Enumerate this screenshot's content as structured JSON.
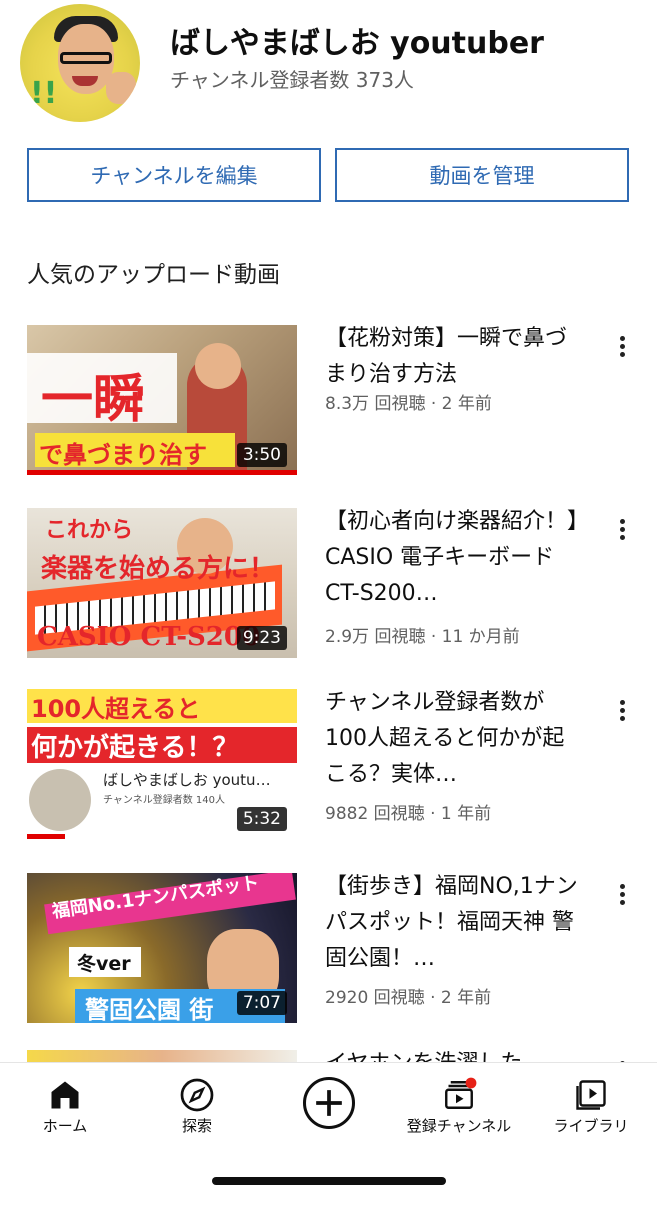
{
  "channel": {
    "name": "ばしやまばしお youtuber",
    "subscribers": "チャンネル登録者数 373人"
  },
  "buttons": {
    "edit": "チャンネルを編集",
    "manage": "動画を管理"
  },
  "section": {
    "title": "人気のアップロード動画"
  },
  "videos": [
    {
      "title": "【花粉対策】一瞬で鼻づまり治す方法",
      "meta": "8.3万 回視聴 · 2 年前",
      "duration": "3:50",
      "watched_fraction": 1.0,
      "thumb_text": [
        "一瞬",
        "で鼻づまり治す"
      ]
    },
    {
      "title": "【初心者向け楽器紹介！】CASIO 電子キーボード　CT-S200…",
      "meta": "2.9万 回視聴 · 11 か月前",
      "duration": "9:23",
      "watched_fraction": 0,
      "thumb_text": [
        "これから",
        "楽器を始める方に！",
        "CASIO CT-S200"
      ]
    },
    {
      "title": "チャンネル登録者数が100人超えると何かが起こる？実体…",
      "meta": "9882 回視聴 · 1 年前",
      "duration": "5:32",
      "watched_fraction": 0.14,
      "thumb_text": [
        "100人超えると",
        "何かが起きる！？",
        "ばしやまばしお youtu…",
        "チャンネル登録者数 140人"
      ]
    },
    {
      "title": "【街歩き】福岡NO,1ナンパスポット！福岡天神 警固公園！…",
      "meta": "2920 回視聴 · 2 年前",
      "duration": "7:07",
      "watched_fraction": 0,
      "thumb_text": [
        "福岡No.1ナンパスポット",
        "冬ver",
        "警固公園 街"
      ]
    },
    {
      "title": "イヤホンを洗濯した…"
    }
  ],
  "nav": {
    "home": "ホーム",
    "explore": "探索",
    "subscriptions": "登録チャンネル",
    "library": "ライブラリ"
  },
  "colors": {
    "accent": "#2f6ab3",
    "progress": "#e00000",
    "badge": "#e62117"
  }
}
